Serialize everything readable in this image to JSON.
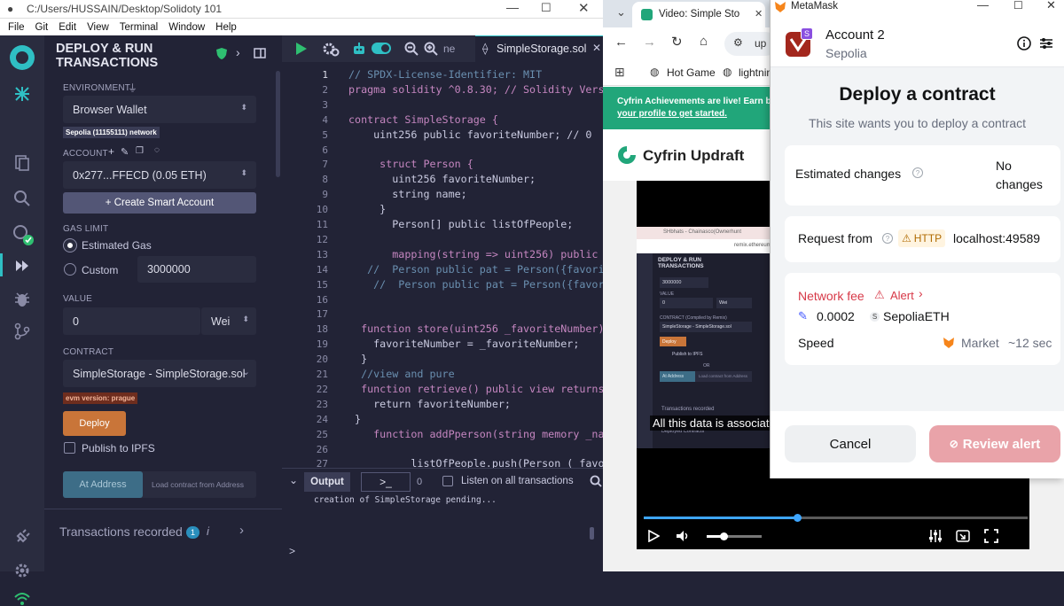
{
  "remix": {
    "title_path": "C:/Users/HUSSAIN/Desktop/Solidoty 101",
    "menu": [
      "File",
      "Git",
      "Edit",
      "View",
      "Terminal",
      "Window",
      "Help"
    ],
    "panel_title_1": "DEPLOY & RUN",
    "panel_title_2": "TRANSACTIONS",
    "environment_label": "ENVIRONMENT",
    "environment_value": "Browser Wallet",
    "network_badge": "Sepolia (11155111) network",
    "account_label": "ACCOUNT",
    "account_value": "0x277...FFECD (0.05 ETH)",
    "create_smart_account": "+ Create Smart Account",
    "gas_limit_label": "GAS LIMIT",
    "estimated_gas": "Estimated Gas",
    "custom": "Custom",
    "gas_value": "3000000",
    "value_label": "VALUE",
    "value_amount": "0",
    "value_unit": "Wei",
    "contract_label": "CONTRACT",
    "contract_value": "SimpleStorage - SimpleStorage.sol",
    "evm_badge": "evm version: prague",
    "deploy": "Deploy",
    "publish_ipfs": "Publish to IPFS",
    "at_address": "At Address",
    "load_contract": "Load contract from Address",
    "tx_recorded": "Transactions recorded",
    "tx_count": "1",
    "tab_file": "SimpleStorage.sol",
    "tab_partial": "ne",
    "terminal_output": "Output",
    "terminal_count": "0",
    "listen_all": "Listen on all transactions",
    "terminal_log": "creation of SimpleStorage pending...",
    "prompt": ">",
    "line_numbers": [
      "1",
      "2",
      "3",
      "4",
      "5",
      "6",
      "7",
      "8",
      "9",
      "10",
      "11",
      "12",
      "13",
      "14",
      "15",
      "16",
      "17",
      "18",
      "19",
      "20",
      "21",
      "22",
      "23",
      "24",
      "25",
      "26",
      "27"
    ],
    "code_lines": [
      "// SPDX-License-Identifier: MIT",
      "pragma solidity ^0.8.30; // Solidity Versi",
      "",
      "contract SimpleStorage {",
      "    uint256 public favoriteNumber; // 0",
      "",
      "     struct Person {",
      "       uint256 favoriteNumber;",
      "       string name;",
      "     }",
      "       Person[] public listOfPeople;",
      "",
      "       mapping(string => uint256) public",
      "   //  Person public pat = Person({favorit",
      "    //  Person public pat = Person({favori",
      "",
      "",
      "  function store(uint256 _favoriteNumber) p",
      "    favoriteNumber = _favoriteNumber;",
      "  }",
      "  //view and pure",
      "  function retrieve() public view returns(u",
      "    return favoriteNumber;",
      " }",
      "    function addPperson(string memory _name",
      "",
      "          listOfPeople.push(Person (_favori"
    ]
  },
  "browser": {
    "tab_title": "Video: Simple Sto",
    "address_partial": "up",
    "bookmark_1": "Hot Game",
    "bookmark_2": "lightnin",
    "banner_line1": "Cyfrin Achievements are live! Earn ba",
    "banner_line2": "your profile to get started.",
    "brand": "Cyfrin Updraft",
    "caption": "All this data is associate",
    "video_progress_pct": 40,
    "inner": {
      "title": "DEPLOY & RUN\nTRANSACTIONS",
      "gas": "3000000",
      "value_label": "VALUE",
      "value": "0",
      "unit": "Wei",
      "contract_label": "CONTRACT (Compiled by Remix)",
      "contract": "SimpleStorage - SimpleStorage.sol",
      "deploy": "Deploy",
      "publish": "Publish to IPFS",
      "or": "OR",
      "at_address": "At Address",
      "load": "Load contract from Address",
      "tx": "Transactions recorded",
      "deployed": "Deployed Contracts",
      "tab1": "SHbhats - Chainasco(Ownerhunt",
      "url": "remix.ethereum.org"
    }
  },
  "metamask": {
    "app": "MetaMask",
    "account": "Account 2",
    "account_initial": "S",
    "network": "Sepolia",
    "heading": "Deploy a contract",
    "subheading": "This site wants you to deploy a contract",
    "est_changes": "Estimated changes",
    "no_changes": "No changes",
    "request_from": "Request from",
    "http": "HTTP",
    "origin": "localhost:49589",
    "network_fee": "Network fee",
    "alert": "Alert",
    "fee_amount": "0.0002",
    "fee_currency": "SepoliaETH",
    "speed": "Speed",
    "speed_value": "Market",
    "speed_time": "~12 sec",
    "cancel": "Cancel",
    "review_alert": "Review alert"
  },
  "colors": {
    "remix_bg": "#222336",
    "remix_accent": "#2fbfc4",
    "deploy_orange": "#c97539",
    "mm_red": "#d73847",
    "mm_review_bg": "#e9a3a9",
    "cyfrin_green": "#21a67a"
  }
}
